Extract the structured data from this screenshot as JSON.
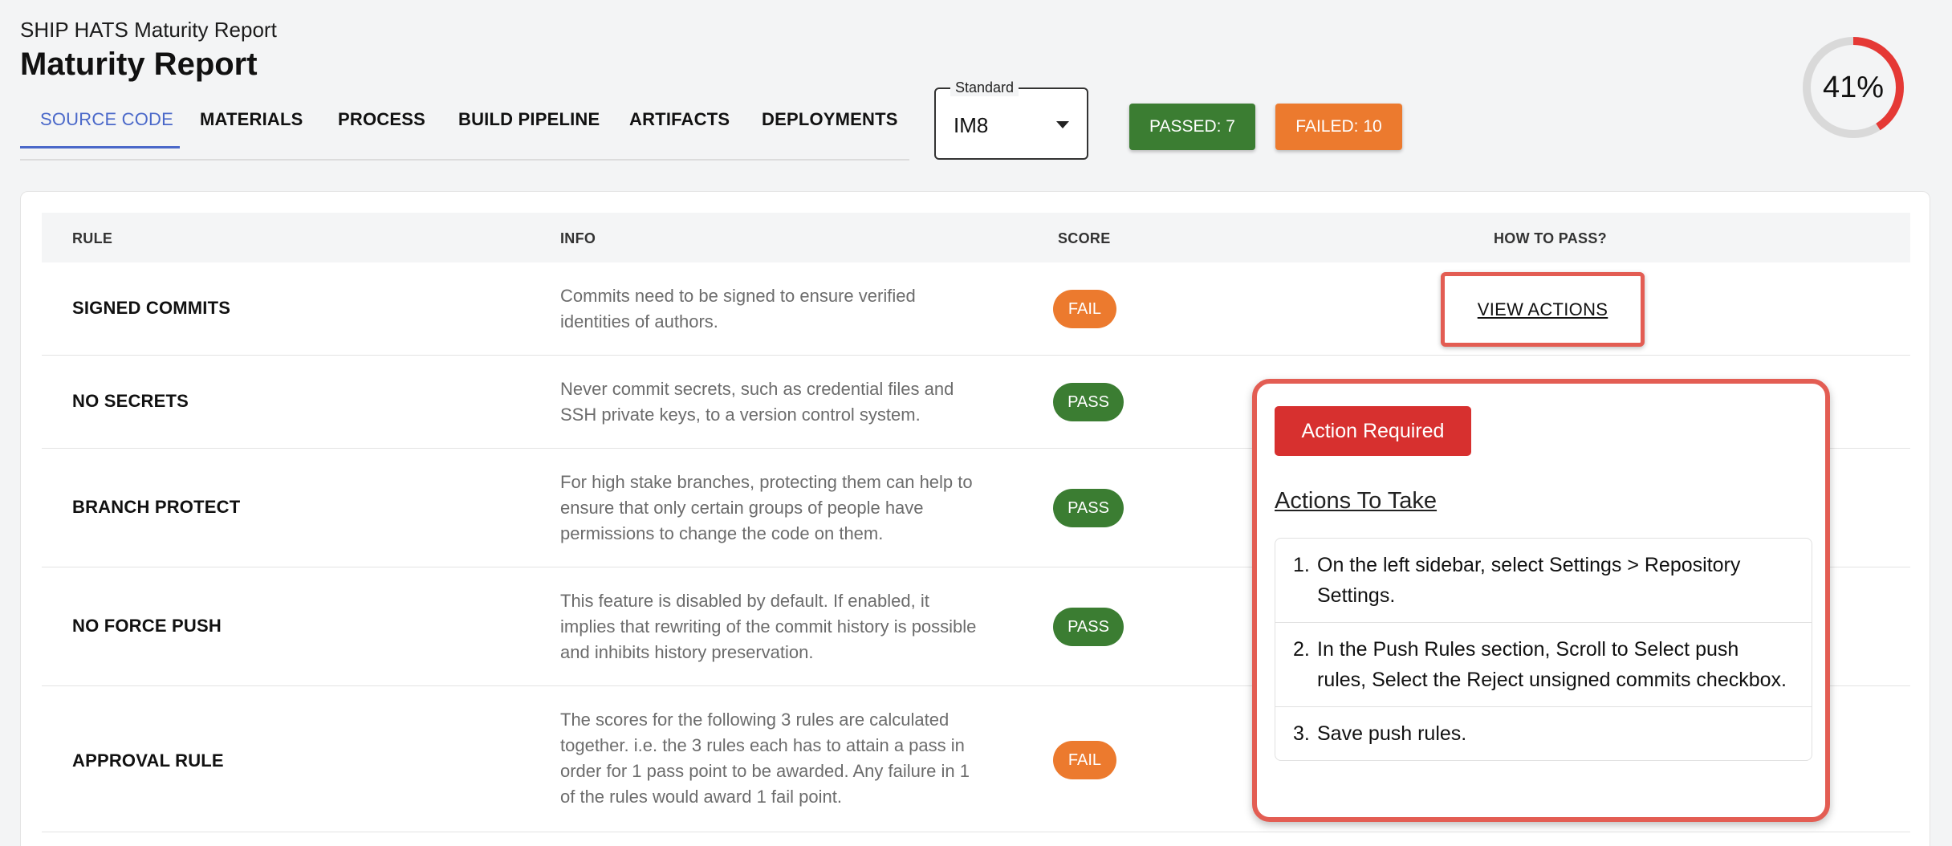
{
  "header": {
    "app_subtitle": "SHIP HATS Maturity Report",
    "page_title": "Maturity Report"
  },
  "tabs": [
    {
      "label": "SOURCE CODE",
      "active": true
    },
    {
      "label": "MATERIALS",
      "active": false
    },
    {
      "label": "PROCESS",
      "active": false
    },
    {
      "label": "BUILD PIPELINE",
      "active": false
    },
    {
      "label": "ARTIFACTS",
      "active": false
    },
    {
      "label": "DEPLOYMENTS",
      "active": false
    }
  ],
  "standard_select": {
    "legend": "Standard",
    "value": "IM8"
  },
  "summary": {
    "passed_label": "PASSED: 7",
    "failed_label": "FAILED: 10",
    "progress_text": "41%",
    "progress_value": 0.41
  },
  "table": {
    "headers": {
      "rule": "RULE",
      "info": "INFO",
      "score": "SCORE",
      "how_to_pass": "HOW TO PASS?"
    },
    "rows": [
      {
        "rule": "SIGNED COMMITS",
        "info": "Commits need to be signed to ensure verified identities of authors.",
        "score": "FAIL",
        "action": "VIEW ACTIONS"
      },
      {
        "rule": "NO SECRETS",
        "info": "Never commit secrets, such as credential files and SSH private keys, to a version control system.",
        "score": "PASS"
      },
      {
        "rule": "BRANCH PROTECT",
        "info": "For high stake branches, protecting them can help to ensure that only certain groups of people have permissions to change the code on them.",
        "score": "PASS"
      },
      {
        "rule": "NO FORCE PUSH",
        "info": "This feature is disabled by default. If enabled, it implies that rewriting of the commit history is possible and inhibits history preservation.",
        "score": "PASS"
      },
      {
        "rule": "APPROVAL RULE",
        "info": "The scores for the following 3 rules are calculated together. i.e. the 3 rules each has to attain a pass in order for 1 pass point to be awarded. Any failure in 1 of the rules would award 1 fail point.",
        "score": "FAIL"
      }
    ]
  },
  "popover": {
    "badge": "Action Required",
    "title": "Actions To Take",
    "steps": [
      "On the left sidebar, select Settings > Repository Settings.",
      "In the Push Rules section, Scroll to Select push rules, Select the Reject unsigned commits checkbox.",
      "Save push rules."
    ]
  },
  "colors": {
    "accent": "#4a68c9",
    "pass": "#3b7d32",
    "fail": "#ec7a2e",
    "action_required": "#d7302f",
    "highlight": "#e35d53",
    "progress": "#e53935"
  }
}
